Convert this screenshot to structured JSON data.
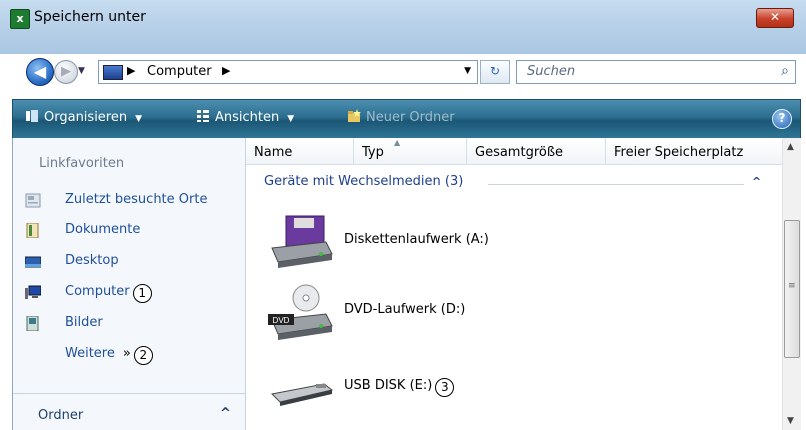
{
  "window": {
    "title": "Speichern unter",
    "app_icon_glyph": "x",
    "close_glyph": "✕"
  },
  "nav": {
    "back_glyph": "◀",
    "forward_glyph": "▶",
    "address_segments": [
      "Computer"
    ],
    "search_placeholder": "Suchen",
    "refresh_glyph": "↻"
  },
  "toolbar": {
    "organize_label": "Organisieren",
    "views_label": "Ansichten",
    "new_folder_label": "Neuer Ordner",
    "help_glyph": "?"
  },
  "sidebar": {
    "header": "Linkfavoriten",
    "items": [
      {
        "label": "Zuletzt besuchte Orte",
        "icon": "recent-places-icon",
        "callout": ""
      },
      {
        "label": "Dokumente",
        "icon": "documents-icon",
        "callout": ""
      },
      {
        "label": "Desktop",
        "icon": "desktop-icon",
        "callout": ""
      },
      {
        "label": "Computer",
        "icon": "computer-icon",
        "callout": "1"
      },
      {
        "label": "Bilder",
        "icon": "pictures-icon",
        "callout": ""
      }
    ],
    "more_label": "Weitere",
    "more_chevron": "»",
    "more_callout": "2",
    "folders_label": "Ordner",
    "folders_chevron": "^"
  },
  "columns": [
    "Name",
    "Typ",
    "Gesamtgröße",
    "Freier Speicherplatz"
  ],
  "group": {
    "label": "Geräte mit Wechselmedien (3)",
    "chevron": "^"
  },
  "drives": [
    {
      "label": "Diskettenlaufwerk (A:)",
      "icon": "floppy-drive-icon",
      "callout": ""
    },
    {
      "label": "DVD-Laufwerk (D:)",
      "icon": "dvd-drive-icon",
      "badge": "DVD",
      "callout": ""
    },
    {
      "label": "USB DISK (E:)",
      "icon": "usb-drive-icon",
      "callout": "3"
    }
  ],
  "colors": {
    "toolbar": "#1b5675",
    "link": "#1f4f9a",
    "group_header": "#1e3f8a"
  }
}
